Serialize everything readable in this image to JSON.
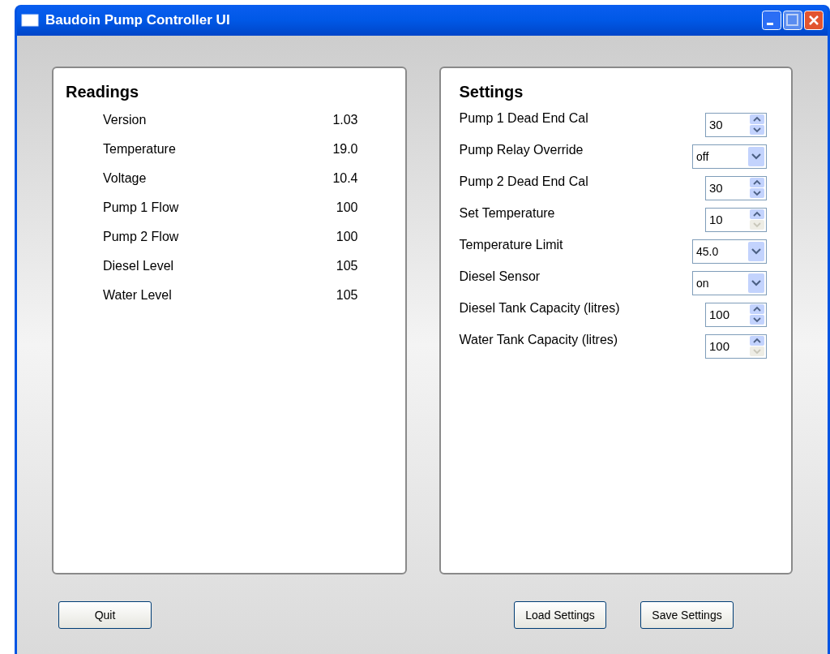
{
  "window": {
    "title": "Baudoin Pump Controller UI"
  },
  "readings": {
    "title": "Readings",
    "rows": [
      {
        "label": "Version",
        "value": "1.03"
      },
      {
        "label": "Temperature",
        "value": "19.0"
      },
      {
        "label": "Voltage",
        "value": "10.4"
      },
      {
        "label": "Pump 1 Flow",
        "value": "100"
      },
      {
        "label": "Pump 2 Flow",
        "value": "100"
      },
      {
        "label": "Diesel Level",
        "value": "105"
      },
      {
        "label": "Water Level",
        "value": "105"
      }
    ]
  },
  "settings": {
    "title": "Settings",
    "rows": [
      {
        "label": "Pump 1 Dead End Cal",
        "kind": "spin",
        "value": "30",
        "down_disabled": false
      },
      {
        "label": "Pump Relay Override",
        "kind": "combo",
        "value": "off"
      },
      {
        "label": "Pump 2 Dead End Cal",
        "kind": "spin",
        "value": "30",
        "down_disabled": false
      },
      {
        "label": "Set Temperature",
        "kind": "spin",
        "value": "10",
        "down_disabled": true
      },
      {
        "label": "Temperature Limit",
        "kind": "combo",
        "value": "45.0"
      },
      {
        "label": "Diesel Sensor",
        "kind": "combo",
        "value": "on"
      },
      {
        "label": "Diesel Tank Capacity (litres)",
        "kind": "spin",
        "value": "100",
        "down_disabled": false
      },
      {
        "label": "Water Tank Capacity (litres)",
        "kind": "spin",
        "value": "100",
        "down_disabled": true
      }
    ]
  },
  "buttons": {
    "quit": "Quit",
    "load": "Load Settings",
    "save": "Save Settings"
  }
}
